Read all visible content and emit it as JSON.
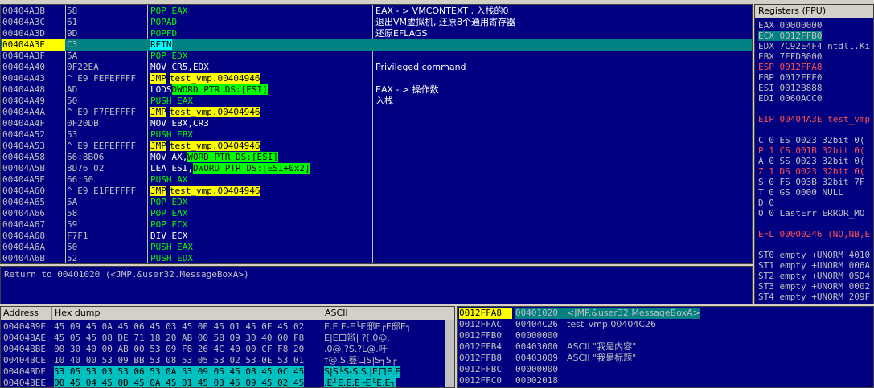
{
  "disasm": {
    "rows": [
      {
        "addr": "00404A3B",
        "hex": "58",
        "mnem": "POP EAX",
        "mnem_op": "",
        "mnem_hl": "",
        "comment": "EAX - > VMCONTEXT , 入栈的0",
        "selected": false
      },
      {
        "addr": "00404A3C",
        "hex": "61",
        "mnem": "POPAD",
        "mnem_op": "",
        "mnem_hl": "",
        "comment": "退出VM虚拟机, 还原8个通用寄存器",
        "selected": false
      },
      {
        "addr": "00404A3D",
        "hex": "9D",
        "mnem": "POPFD",
        "mnem_op": "",
        "mnem_hl": "",
        "comment": "还原EFLAGS",
        "selected": false
      },
      {
        "addr": "00404A3E",
        "hex": "C3",
        "mnem": "RETN",
        "mnem_op": "",
        "mnem_hl": "c",
        "comment": "",
        "selected": true
      },
      {
        "addr": "00404A3F",
        "hex": "5A",
        "mnem": "POP EDX",
        "mnem_op": "",
        "mnem_hl": "",
        "comment": "",
        "selected": false
      },
      {
        "addr": "00404A40",
        "hex": "0F22EA",
        "mnem": "MOV CR5,EDX",
        "mnem_op": "",
        "mnem_hl": "",
        "comment": "Privileged command",
        "selected": false
      },
      {
        "addr": "00404A43",
        "hex": "^ E9 FEFEFFFF",
        "mnem": "JMP",
        "mnem_op": "test_vmp.00404946",
        "mnem_hl": "y",
        "comment": "",
        "selected": false
      },
      {
        "addr": "00404A48",
        "hex": "AD",
        "mnem": "LODS",
        "mnem_op": "DWORD PTR DS:[ESI]",
        "mnem_hl": "g",
        "comment": "EAX - > 操作数",
        "selected": false
      },
      {
        "addr": "00404A49",
        "hex": "50",
        "mnem": "PUSH EAX",
        "mnem_op": "",
        "mnem_hl": "",
        "comment": "入栈",
        "selected": false
      },
      {
        "addr": "00404A4A",
        "hex": "^ E9 F7FEFFFF",
        "mnem": "JMP",
        "mnem_op": "test_vmp.00404946",
        "mnem_hl": "y",
        "comment": "",
        "selected": false
      },
      {
        "addr": "00404A4F",
        "hex": "0F20DB",
        "mnem": "MOV EBX,CR3",
        "mnem_op": "",
        "mnem_hl": "",
        "comment": "",
        "selected": false
      },
      {
        "addr": "00404A52",
        "hex": "53",
        "mnem": "PUSH EBX",
        "mnem_op": "",
        "mnem_hl": "",
        "comment": "",
        "selected": false
      },
      {
        "addr": "00404A53",
        "hex": "^ E9 EEFEFFFF",
        "mnem": "JMP",
        "mnem_op": "test_vmp.00404946",
        "mnem_hl": "y",
        "comment": "",
        "selected": false
      },
      {
        "addr": "00404A58",
        "hex": "66:8B06",
        "mnem": "MOV AX,",
        "mnem_op": "WORD PTR DS:[ESI]",
        "mnem_hl": "g",
        "comment": "",
        "selected": false
      },
      {
        "addr": "00404A5B",
        "hex": "8D76 02",
        "mnem": "LEA ESI,",
        "mnem_op": "DWORD PTR DS:[ESI+0x2]",
        "mnem_hl": "g",
        "comment": "",
        "selected": false
      },
      {
        "addr": "00404A5E",
        "hex": "66:50",
        "mnem": "PUSH AX",
        "mnem_op": "",
        "mnem_hl": "",
        "comment": "",
        "selected": false
      },
      {
        "addr": "00404A60",
        "hex": "^ E9 E1FEFFFF",
        "mnem": "JMP",
        "mnem_op": "test_vmp.00404946",
        "mnem_hl": "y",
        "comment": "",
        "selected": false
      },
      {
        "addr": "00404A65",
        "hex": "5A",
        "mnem": "POP EDX",
        "mnem_op": "",
        "mnem_hl": "",
        "comment": "",
        "selected": false
      },
      {
        "addr": "00404A66",
        "hex": "58",
        "mnem": "POP EAX",
        "mnem_op": "",
        "mnem_hl": "",
        "comment": "",
        "selected": false
      },
      {
        "addr": "00404A67",
        "hex": "59",
        "mnem": "POP ECX",
        "mnem_op": "",
        "mnem_hl": "",
        "comment": "",
        "selected": false
      },
      {
        "addr": "00404A68",
        "hex": "F7F1",
        "mnem": "DIV ECX",
        "mnem_op": "",
        "mnem_hl": "",
        "comment": "",
        "selected": false
      },
      {
        "addr": "00404A6A",
        "hex": "50",
        "mnem": "PUSH EAX",
        "mnem_op": "",
        "mnem_hl": "",
        "comment": "",
        "selected": false
      },
      {
        "addr": "00404A6B",
        "hex": "52",
        "mnem": "PUSH EDX",
        "mnem_op": "",
        "mnem_hl": "",
        "comment": "",
        "selected": false
      }
    ]
  },
  "info_line": "Return to 00401020 (<JMP.&user32.MessageBoxA>)",
  "registers": {
    "title": "Registers (FPU)",
    "rows": [
      {
        "text": "EAX 00000000",
        "hl": ""
      },
      {
        "text": "ECX 0012FFB0",
        "hl": "c"
      },
      {
        "text": "EDX 7C92E4F4 ntdll.Ki",
        "hl": ""
      },
      {
        "text": "EBX 7FFD8000",
        "hl": ""
      },
      {
        "text": "ESP 0012FFA8",
        "hl": "r"
      },
      {
        "text": "EBP 0012FFF0",
        "hl": ""
      },
      {
        "text": "ESI 0012B888",
        "hl": ""
      },
      {
        "text": "EDI 0060ACC0",
        "hl": ""
      },
      {
        "text": "",
        "hl": ""
      },
      {
        "text": "EIP 00404A3E test_vmp",
        "hl": "r"
      },
      {
        "text": "",
        "hl": ""
      },
      {
        "text": "C 0  ES 0023 32bit 0(",
        "hl": ""
      },
      {
        "text": "P 1  CS 001B 32bit 0(",
        "hl": "r"
      },
      {
        "text": "A 0  SS 0023 32bit 0(",
        "hl": ""
      },
      {
        "text": "Z 1  DS 0023 32bit 0(",
        "hl": "r"
      },
      {
        "text": "S 0  FS 003B 32bit 7F",
        "hl": ""
      },
      {
        "text": "T 0  GS 0000 NULL",
        "hl": ""
      },
      {
        "text": "D 0",
        "hl": ""
      },
      {
        "text": "O 0  LastErr ERROR_MO",
        "hl": ""
      },
      {
        "text": "",
        "hl": ""
      },
      {
        "text": "EFL 00000246 (NO,NB,E",
        "hl": "r"
      },
      {
        "text": "",
        "hl": ""
      },
      {
        "text": "ST0 empty +UNORM 4010",
        "hl": ""
      },
      {
        "text": "ST1 empty +UNORM 006A",
        "hl": ""
      },
      {
        "text": "ST2 empty +UNORM 05D4",
        "hl": ""
      },
      {
        "text": "ST3 empty +UNORM 0002",
        "hl": ""
      },
      {
        "text": "ST4 empty +UNORM 209F",
        "hl": ""
      }
    ]
  },
  "dump": {
    "headers": {
      "address": "Address",
      "hex": "Hex dump",
      "ascii": "ASCII"
    },
    "rows": [
      {
        "addr": "00404B9E",
        "hex": "45 09 45 0A 45 06 45 03 45 0E 45 01 45 0E 45 02",
        "ascii": "E.E.E-E└E邸E┌E邸E┐",
        "sel": false
      },
      {
        "addr": "00404BAE",
        "hex": "45 05 45 08 DE 71 18 20 AB 00 5B 09 30 40 00 F8",
        "ascii": "E|E口辫| ?[.0@.",
        "sel": false
      },
      {
        "addr": "00404BBE",
        "hex": "00 30 40 00 AB 00 53 09 F8 26 4C 40 00 CF F8 20",
        "ascii": ".0@.?S.?L@.吁",
        "sel": false
      },
      {
        "addr": "00404BCE",
        "hex": "10 40 00 53 09 BB 53 08 53 05 53 02 53 0E 53 01",
        "ascii": "†@.S.簦口S|S┐S┌",
        "sel": false
      },
      {
        "addr": "00404BDE",
        "hex": "53 05 53 03 53 06 53 0A 53 09 05 45 08 45 0C 45",
        "ascii": "S|S└S-S.S.|E口E.E",
        "sel": true
      },
      {
        "addr": "00404BEE",
        "hex": "00 45 04 45 0D 45 0A 45 01 45 03 45 09 45 02 45",
        "ascii": ".E┘E.E.E┌E└E.E┐",
        "sel": true
      }
    ]
  },
  "stack": {
    "rows": [
      {
        "addr": "0012FFA8",
        "val": "00401020",
        "cmt": "<JMP.&user32.MessageBoxA>",
        "sel": true
      },
      {
        "addr": "0012FFAC",
        "val": "00404C26",
        "cmt": "test_vmp.00404C26",
        "sel": false
      },
      {
        "addr": "0012FFB0",
        "val": "00000000",
        "cmt": "",
        "sel": false
      },
      {
        "addr": "0012FFB4",
        "val": "00403000",
        "cmt": "ASCII \"我是内容\"",
        "sel": false
      },
      {
        "addr": "0012FFB8",
        "val": "00403009",
        "cmt": "ASCII \"我是标题\"",
        "sel": false
      },
      {
        "addr": "0012FFBC",
        "val": "00000000",
        "cmt": "",
        "sel": false
      },
      {
        "addr": "0012FFC0",
        "val": "00002018",
        "cmt": "",
        "sel": false
      }
    ]
  }
}
